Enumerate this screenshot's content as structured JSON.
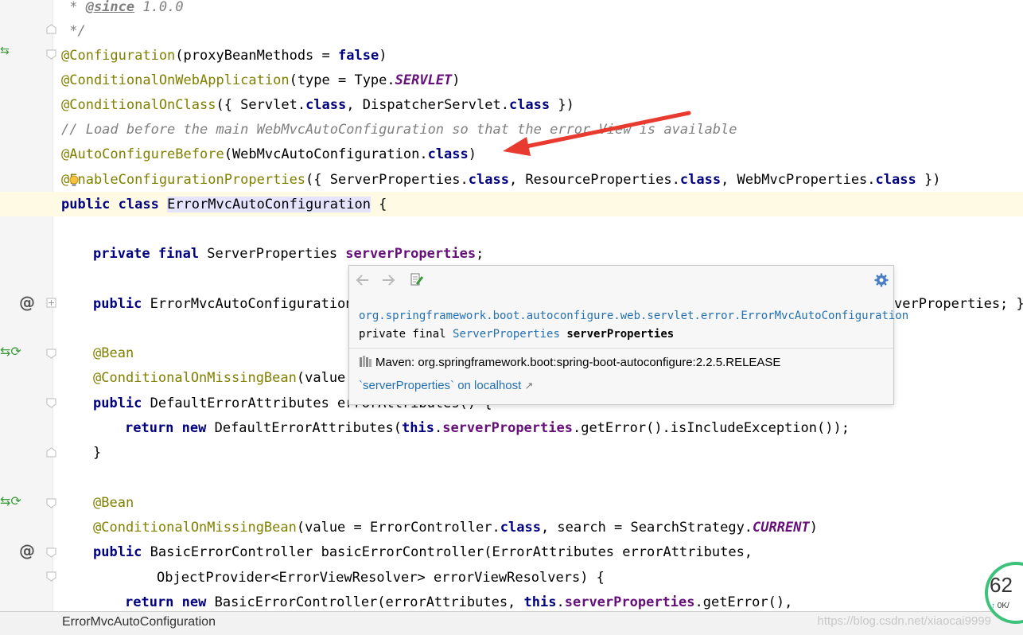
{
  "code": {
    "l0": {
      "tag": "@since",
      "rest": " 1.0.0"
    },
    "l1": " */",
    "l2": {
      "ann": "@Configuration",
      "p1": "(proxyBeanMethods = ",
      "kw": "false",
      "p2": ")"
    },
    "l3": {
      "ann": "@ConditionalOnWebApplication",
      "p1": "(type = Type.",
      "st": "SERVLET",
      "p2": ")"
    },
    "l4": {
      "ann": "@ConditionalOnClass",
      "p1": "({ Servlet.",
      "kw1": "class",
      "p2": ", DispatcherServlet.",
      "kw2": "class",
      "p3": " })"
    },
    "l5": "// Load before the main WebMvcAutoConfiguration so that the error View is available",
    "l6": {
      "ann": "@AutoConfigureBefore",
      "p1": "(WebMvcAutoConfiguration.",
      "kw": "class",
      "p2": ")"
    },
    "l7": {
      "ann": "@EnableConfigurationProperties",
      "p1": "({ ServerProperties.",
      "kw1": "class",
      "p2": ", ResourceProperties.",
      "kw2": "class",
      "p3": ", WebMvcProperties.",
      "kw3": "class",
      "p4": " })"
    },
    "l8": {
      "kw": "public class ",
      "ident": "ErrorMvcAutoConfiguration",
      "rest": " {"
    },
    "l10": {
      "kw": "private final ",
      "type": "ServerProperties ",
      "field": "serverProperties",
      "rest": ";"
    },
    "l12": {
      "kw": "public ",
      "p1": "ErrorMvcAutoConfiguration",
      "tail": "verProperties; }"
    },
    "l14": "@Bean",
    "l15": {
      "ann": "@ConditionalOnMissingBean",
      "p1": "(value"
    },
    "l16": {
      "kw": "public ",
      "p1": "DefaultErrorAttributes errorAttributes() {"
    },
    "l17": {
      "kw1": "return new ",
      "p1": "DefaultErrorAttributes(",
      "kw2": "this",
      "p2": ".",
      "field": "serverProperties",
      "p3": ".getError().isIncludeException());"
    },
    "l18": "}",
    "l20": "@Bean",
    "l21": {
      "ann": "@ConditionalOnMissingBean",
      "p1": "(value = ErrorController.",
      "kw": "class",
      "p2": ", search = SearchStrategy.",
      "st": "CURRENT",
      "p3": ")"
    },
    "l22": {
      "kw": "public ",
      "p1": "BasicErrorController basicErrorController(ErrorAttributes errorAttributes,"
    },
    "l23": "ObjectProvider<ErrorViewResolver> errorViewResolvers) {",
    "l24": {
      "kw1": "return new ",
      "p1": "BasicErrorController(errorAttributes, ",
      "kw2": "this",
      "p2": ".",
      "field": "serverProperties",
      "p3": ".getError(),"
    }
  },
  "popup": {
    "qualified_class": "org.springframework.boot.autoconfigure.web.servlet.error.ErrorMvcAutoConfiguration",
    "decl_prefix": "private final ",
    "decl_type": "ServerProperties",
    "decl_name": "serverProperties",
    "maven": "Maven: org.springframework.boot:spring-boot-autoconfigure:2.2.5.RELEASE",
    "external_link": "`serverProperties` on localhost",
    "external_arrow": "↗"
  },
  "statusbar": {
    "breadcrumb": "ErrorMvcAutoConfiguration",
    "watermark": "https://blog.csdn.net/xiaocai9999"
  },
  "monitor": {
    "percent": "62",
    "rate": "0K/"
  },
  "colors": {
    "keyword": "#000080",
    "annotation": "#808000",
    "comment": "#808080",
    "field": "#660e7a",
    "arrow": "#e83a2f",
    "link": "#2470b3"
  },
  "icons": [
    "fold-marker-icon",
    "implements-icon",
    "override-at-icon",
    "back-icon",
    "forward-icon",
    "edit-source-icon",
    "gear-icon",
    "library-icon",
    "external-link-icon",
    "bulb-icon"
  ]
}
